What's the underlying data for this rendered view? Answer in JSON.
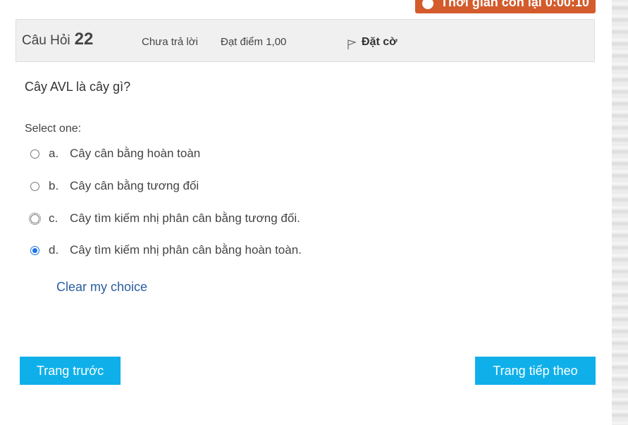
{
  "timer": {
    "label": "Thời gian còn lại 0:00:10"
  },
  "question": {
    "prefix": "Câu Hỏi",
    "number": "22",
    "state": "Chưa trả lời",
    "grade": "Đạt điểm 1,00",
    "flag_label": "Đặt cờ",
    "text": "Cây AVL là cây gì?",
    "prompt": "Select one:",
    "options": [
      {
        "letter": "a.",
        "text": "Cây cân bằng hoàn toàn",
        "checked": false
      },
      {
        "letter": "b.",
        "text": "Cây cân bằng tương đối",
        "checked": false
      },
      {
        "letter": "c.",
        "text": "Cây tìm kiếm nhị phân cân bằng tương đối.",
        "checked": false
      },
      {
        "letter": "d.",
        "text": "Cây tìm kiếm nhị phân cân bằng hoàn toàn.",
        "checked": true
      }
    ],
    "clear_label": "Clear my choice"
  },
  "nav": {
    "prev_label": "Trang trước",
    "next_label": "Trang tiếp theo"
  }
}
